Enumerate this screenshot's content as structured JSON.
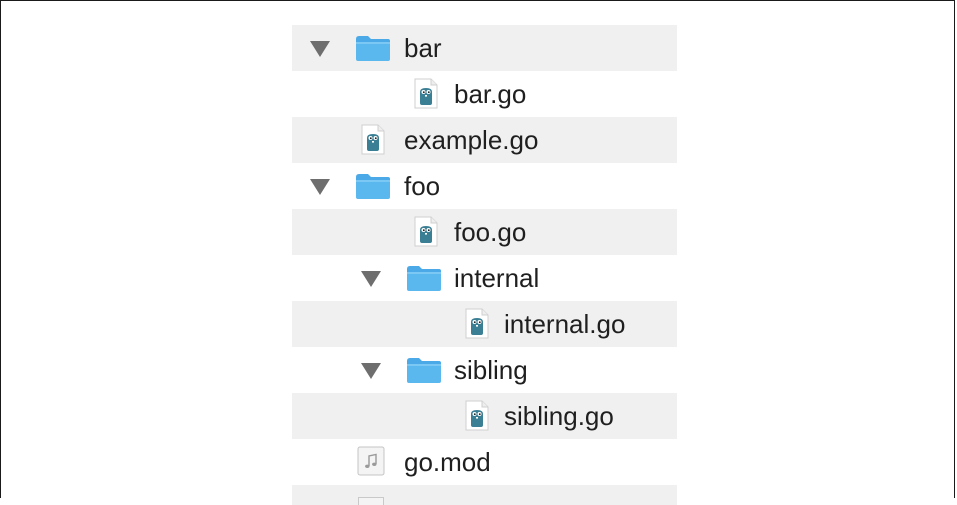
{
  "file_tree": {
    "items": [
      {
        "label": "bar",
        "type": "folder",
        "icon": "folder-icon",
        "expanded": true
      },
      {
        "label": "bar.go",
        "type": "file",
        "icon": "go-file-icon"
      },
      {
        "label": "example.go",
        "type": "file",
        "icon": "go-file-icon"
      },
      {
        "label": "foo",
        "type": "folder",
        "icon": "folder-icon",
        "expanded": true
      },
      {
        "label": "foo.go",
        "type": "file",
        "icon": "go-file-icon"
      },
      {
        "label": "internal",
        "type": "folder",
        "icon": "folder-icon",
        "expanded": true
      },
      {
        "label": "internal.go",
        "type": "file",
        "icon": "go-file-icon"
      },
      {
        "label": "sibling",
        "type": "folder",
        "icon": "folder-icon",
        "expanded": true
      },
      {
        "label": "sibling.go",
        "type": "file",
        "icon": "go-file-icon"
      },
      {
        "label": "go.mod",
        "type": "file",
        "icon": "music-file-icon"
      }
    ]
  },
  "colors": {
    "row_stripe": "#f0f0f0",
    "folder_blue": "#5bb8ef",
    "gopher_teal": "#3b7f95",
    "disclosure_gray": "#6e6e6e"
  }
}
